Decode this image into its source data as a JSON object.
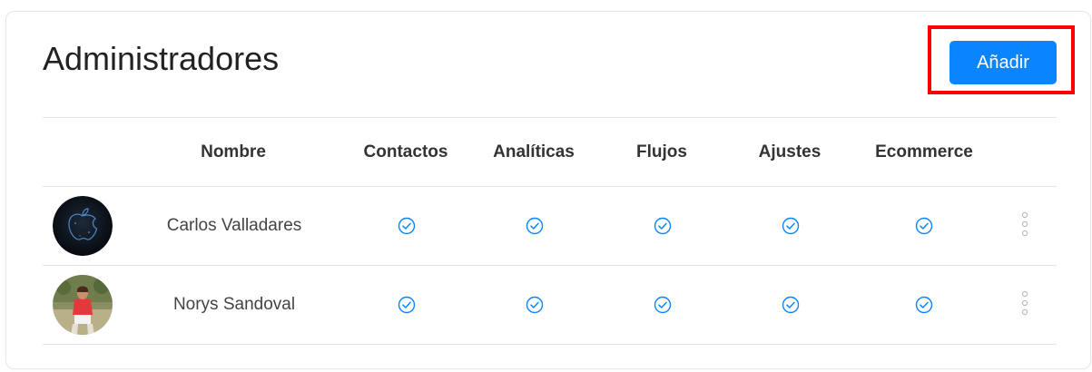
{
  "header": {
    "title": "Administradores",
    "add_label": "Añadir"
  },
  "table": {
    "columns": [
      "Nombre",
      "Contactos",
      "Analíticas",
      "Flujos",
      "Ajustes",
      "Ecommerce"
    ],
    "rows": [
      {
        "name": "Carlos Valladares",
        "avatar": "apple-logo-avatar",
        "permissions": [
          true,
          true,
          true,
          true,
          true
        ]
      },
      {
        "name": "Norys Sandoval",
        "avatar": "person-photo-avatar",
        "permissions": [
          true,
          true,
          true,
          true,
          true
        ]
      }
    ]
  },
  "colors": {
    "accent": "#0a84ff",
    "highlight": "#ff0000",
    "check": "#0a84ff"
  },
  "icons": {
    "check": "check-circle-icon",
    "menu": "more-vertical-icon"
  }
}
